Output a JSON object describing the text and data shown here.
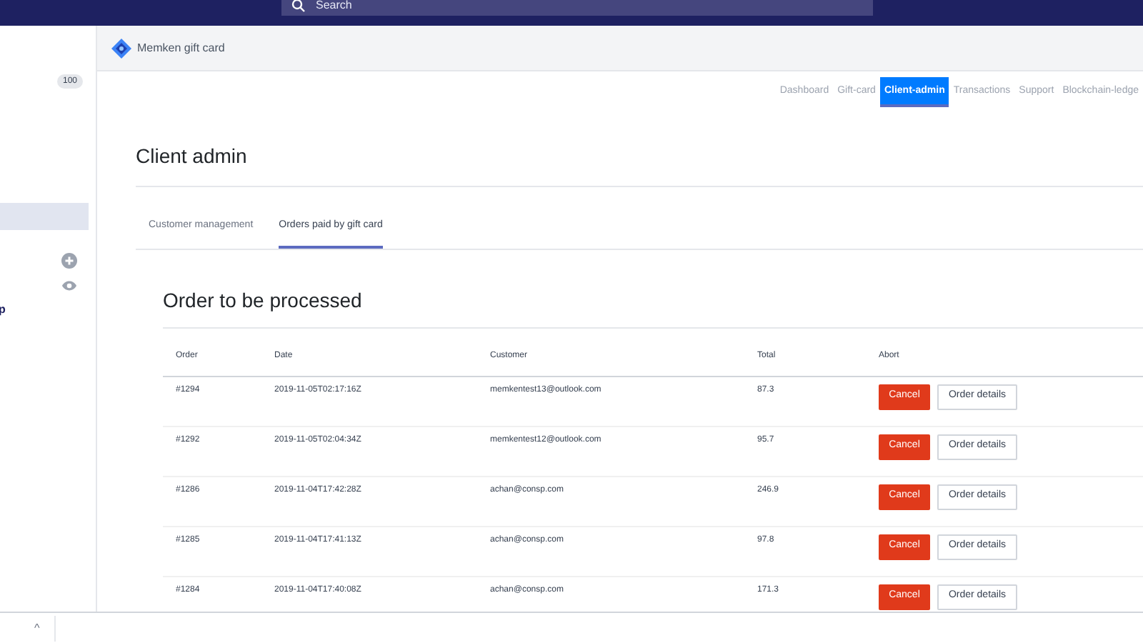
{
  "top_bar": {
    "search": {
      "placeholder": "Search"
    }
  },
  "sidebar": {
    "badge": "100",
    "items": [
      {
        "kind": "selected-row",
        "selected": true
      },
      {
        "kind": "add"
      },
      {
        "kind": "view"
      },
      {
        "kind": "label",
        "label": "p"
      }
    ]
  },
  "header": {
    "app_name": "Memken gift card"
  },
  "nav": [
    {
      "label": "Dashboard",
      "selected": false
    },
    {
      "label": "Gift-card",
      "selected": false
    },
    {
      "label": "Client-admin",
      "selected": true
    },
    {
      "label": "Transactions",
      "selected": false
    },
    {
      "label": "Support",
      "selected": false
    },
    {
      "label": "Blockchain-ledge",
      "selected": false
    }
  ],
  "page_title": "Client admin",
  "tabs": [
    {
      "label": "Customer management",
      "selected": false
    },
    {
      "label": "Orders paid by gift card",
      "selected": true
    }
  ],
  "card": {
    "title": "Order to be processed",
    "table": {
      "columns": [
        "Order",
        "Date",
        "Customer",
        "Total",
        "Abort"
      ],
      "rows": [
        {
          "order": "#1294",
          "date": "2019-11-05T02:17:16Z",
          "customer": "memkentest13@outlook.com",
          "total": "87.3",
          "actions": [
            "Cancel",
            "Order details"
          ]
        },
        {
          "order": "#1292",
          "date": "2019-11-05T02:04:34Z",
          "customer": "memkentest12@outlook.com",
          "total": "95.7",
          "actions": [
            "Cancel",
            "Order details"
          ]
        },
        {
          "order": "#1286",
          "date": "2019-11-04T17:42:28Z",
          "customer": "achan@consp.com",
          "total": "246.9",
          "actions": [
            "Cancel",
            "Order details"
          ]
        },
        {
          "order": "#1285",
          "date": "2019-11-04T17:41:13Z",
          "customer": "achan@consp.com",
          "total": "97.8",
          "actions": [
            "Cancel",
            "Order details"
          ]
        },
        {
          "order": "#1284",
          "date": "2019-11-04T17:40:08Z",
          "customer": "achan@consp.com",
          "total": "171.3",
          "actions": [
            "Cancel",
            "Order details"
          ]
        }
      ]
    }
  },
  "bottom_bar": {
    "caret": "^"
  }
}
